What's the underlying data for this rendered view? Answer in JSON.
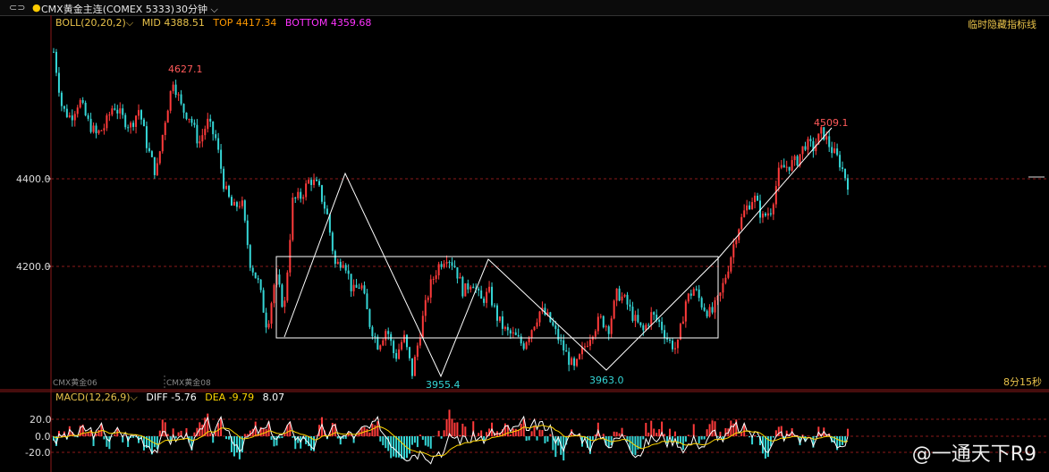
{
  "toolbar": {
    "instrument": "CMX黄金主连(COMEX 5333)",
    "period": "30分钟",
    "right_button": "临时隐藏指标线"
  },
  "boll": {
    "name": "BOLL(20,20,2)",
    "mid_label": "MID",
    "mid_value": "4388.51",
    "top_label": "TOP",
    "top_value": "4417.34",
    "bottom_label": "BOTTOM",
    "bottom_value": "4359.68"
  },
  "macd": {
    "name": "MACD(12,26,9)",
    "diff_label": "DIFF",
    "diff_value": "-5.76",
    "dea_label": "DEA",
    "dea_value": "-9.79",
    "macd_value": "8.07"
  },
  "footer": {
    "contract_1": "CMX黄金06",
    "contract_2": "CMX黄金08",
    "countdown": "8分15秒"
  },
  "watermark": "@一通天下R9",
  "colors": {
    "up": "#ff3b3b",
    "down": "#35d6d6",
    "boll_label": "#e8c24a",
    "top": "#ff9900",
    "bottom": "#ff33ff",
    "diff": "#ffffff",
    "dea": "#ffd700",
    "grid_red": "#8b1a1a",
    "annot": "#ff5a5a",
    "annot_low": "#35d6d6"
  },
  "chart_data": {
    "type": "candlestick",
    "y_ticks": [
      4400.0,
      4200.0
    ],
    "y_tick_labels": [
      "4400.0",
      "4200.0"
    ],
    "ylim": [
      3930,
      4760
    ],
    "annotations": [
      {
        "text": "4627.1",
        "kind": "high"
      },
      {
        "text": "4509.1",
        "kind": "high"
      },
      {
        "text": "3955.4",
        "kind": "low"
      },
      {
        "text": "3963.0",
        "kind": "low"
      }
    ],
    "rectangle": {
      "price_top": 4226,
      "price_bottom": 4048
    },
    "trend_lines": [
      [
        4048,
        4418,
        3955.4,
        4226,
        3963.0,
        4226,
        4509.1
      ]
    ],
    "price_path": [
      4690,
      4560,
      4540,
      4580,
      4530,
      4500,
      4520,
      4570,
      4540,
      4520,
      4560,
      4470,
      4410,
      4530,
      4627.1,
      4560,
      4540,
      4480,
      4530,
      4490,
      4380,
      4330,
      4350,
      4210,
      4160,
      4060,
      4180,
      4100,
      4350,
      4360,
      4400,
      4380,
      4320,
      4200,
      4220,
      4140,
      4160,
      4070,
      4020,
      4060,
      3990,
      4040,
      3955.4,
      4060,
      4150,
      4200,
      4226,
      4200,
      4140,
      4170,
      4120,
      4140,
      4080,
      4050,
      4040,
      4020,
      4060,
      4100,
      4080,
      4040,
      4000,
      3963.0,
      4010,
      4050,
      4080,
      4060,
      4140,
      4120,
      4080,
      4050,
      4090,
      4070,
      4030,
      4010,
      4120,
      4150,
      4110,
      4090,
      4130,
      4200,
      4280,
      4330,
      4360,
      4310,
      4330,
      4420,
      4430,
      4440,
      4480,
      4470,
      4509.1,
      4470,
      4440,
      4390
    ],
    "macd_axis": {
      "ticks": [
        20.0,
        0.0,
        -20.0
      ],
      "tick_labels": [
        "20.0",
        "0.0",
        "-20.0"
      ]
    }
  }
}
